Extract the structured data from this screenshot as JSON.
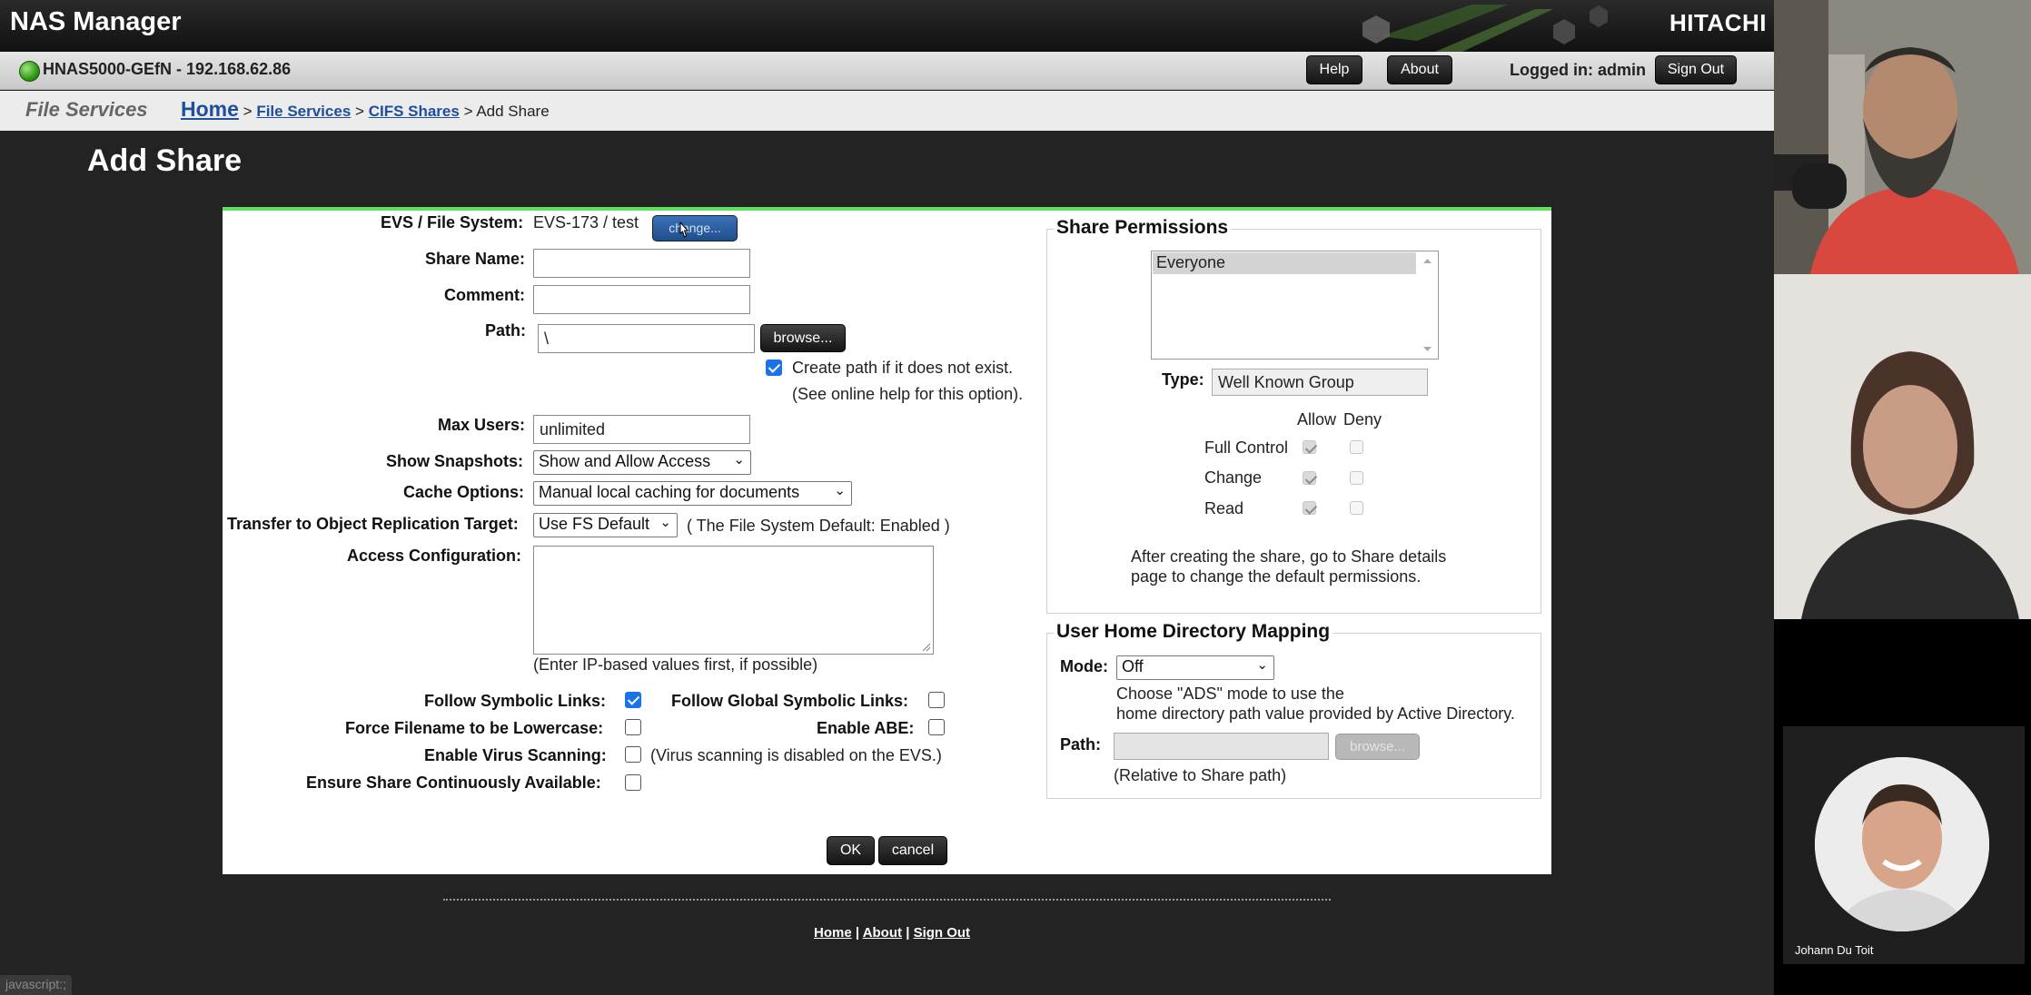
{
  "app": {
    "title": "NAS Manager",
    "brand": "HITACHI"
  },
  "status": {
    "host": "HNAS5000-GEfN - 192.168.62.86",
    "help_label": "Help",
    "about_label": "About",
    "logged_in": "Logged in: admin",
    "signout_label": "Sign Out"
  },
  "nav": {
    "section": "File Services",
    "breadcrumb": {
      "home": "Home",
      "sep": ">",
      "file_services": "File Services",
      "cifs_shares": "CIFS Shares",
      "current": "Add Share"
    }
  },
  "page": {
    "title": "Add Share"
  },
  "form": {
    "evs_label": "EVS / File System:",
    "evs_value": "EVS-173 /  test",
    "change_label": "change...",
    "share_name_label": "Share Name:",
    "share_name_value": "",
    "comment_label": "Comment:",
    "comment_value": "",
    "path_label": "Path:",
    "path_value": "\\",
    "browse_label": "browse...",
    "create_path_checked": true,
    "create_path_text": "Create path if it does not exist.",
    "create_path_help": "(See online help for this option).",
    "max_users_label": "Max Users:",
    "max_users_value": "unlimited",
    "show_snapshots_label": "Show Snapshots:",
    "show_snapshots_value": "Show and Allow Access",
    "cache_options_label": "Cache Options:",
    "cache_options_value": "Manual local caching for documents",
    "transfer_label": "Transfer to Object Replication Target:",
    "transfer_value": "Use FS Default",
    "transfer_note": "( The File System Default: Enabled )",
    "access_config_label": "Access Configuration:",
    "access_config_value": "",
    "access_config_hint": "(Enter IP-based values first, if possible)",
    "follow_symlinks_label": "Follow Symbolic Links:",
    "follow_symlinks_checked": true,
    "follow_global_symlinks_label": "Follow Global Symbolic Links:",
    "follow_global_symlinks_checked": false,
    "force_lowercase_label": "Force Filename to be Lowercase:",
    "force_lowercase_checked": false,
    "enable_abe_label": "Enable ABE:",
    "enable_abe_checked": false,
    "virus_scan_label": "Enable Virus Scanning:",
    "virus_scan_checked": false,
    "virus_scan_note": "(Virus scanning is disabled on the EVS.)",
    "continuous_avail_label": "Ensure Share Continuously Available:",
    "continuous_avail_checked": false,
    "ok_label": "OK",
    "cancel_label": "cancel"
  },
  "permissions": {
    "legend": "Share Permissions",
    "list": [
      "Everyone"
    ],
    "type_label": "Type:",
    "type_value": "Well Known Group",
    "allow_label": "Allow",
    "deny_label": "Deny",
    "rows": [
      {
        "name": "Full Control",
        "allow": true,
        "deny": false
      },
      {
        "name": "Change",
        "allow": true,
        "deny": false
      },
      {
        "name": "Read",
        "allow": true,
        "deny": false
      }
    ],
    "note_line1": "After creating the share, go to Share details",
    "note_line2": "page to change the default permissions."
  },
  "home_dir": {
    "legend": "User Home Directory Mapping",
    "mode_label": "Mode:",
    "mode_value": "Off",
    "mode_hint_line1": "Choose \"ADS\" mode to use the",
    "mode_hint_line2": "home directory path value provided by Active Directory.",
    "path_label": "Path:",
    "browse_label": "browse...",
    "path_hint": "(Relative to Share path)"
  },
  "footer": {
    "home": "Home",
    "about": "About",
    "signout": "Sign Out",
    "sep": "|"
  },
  "browser_status": "javascript:;",
  "video_call": {
    "participant_name": "Johann Du Toit"
  },
  "colors": {
    "accent_green": "#5ee05e",
    "link_blue": "#1f4e9a",
    "checkbox_blue": "#1a73e8"
  }
}
